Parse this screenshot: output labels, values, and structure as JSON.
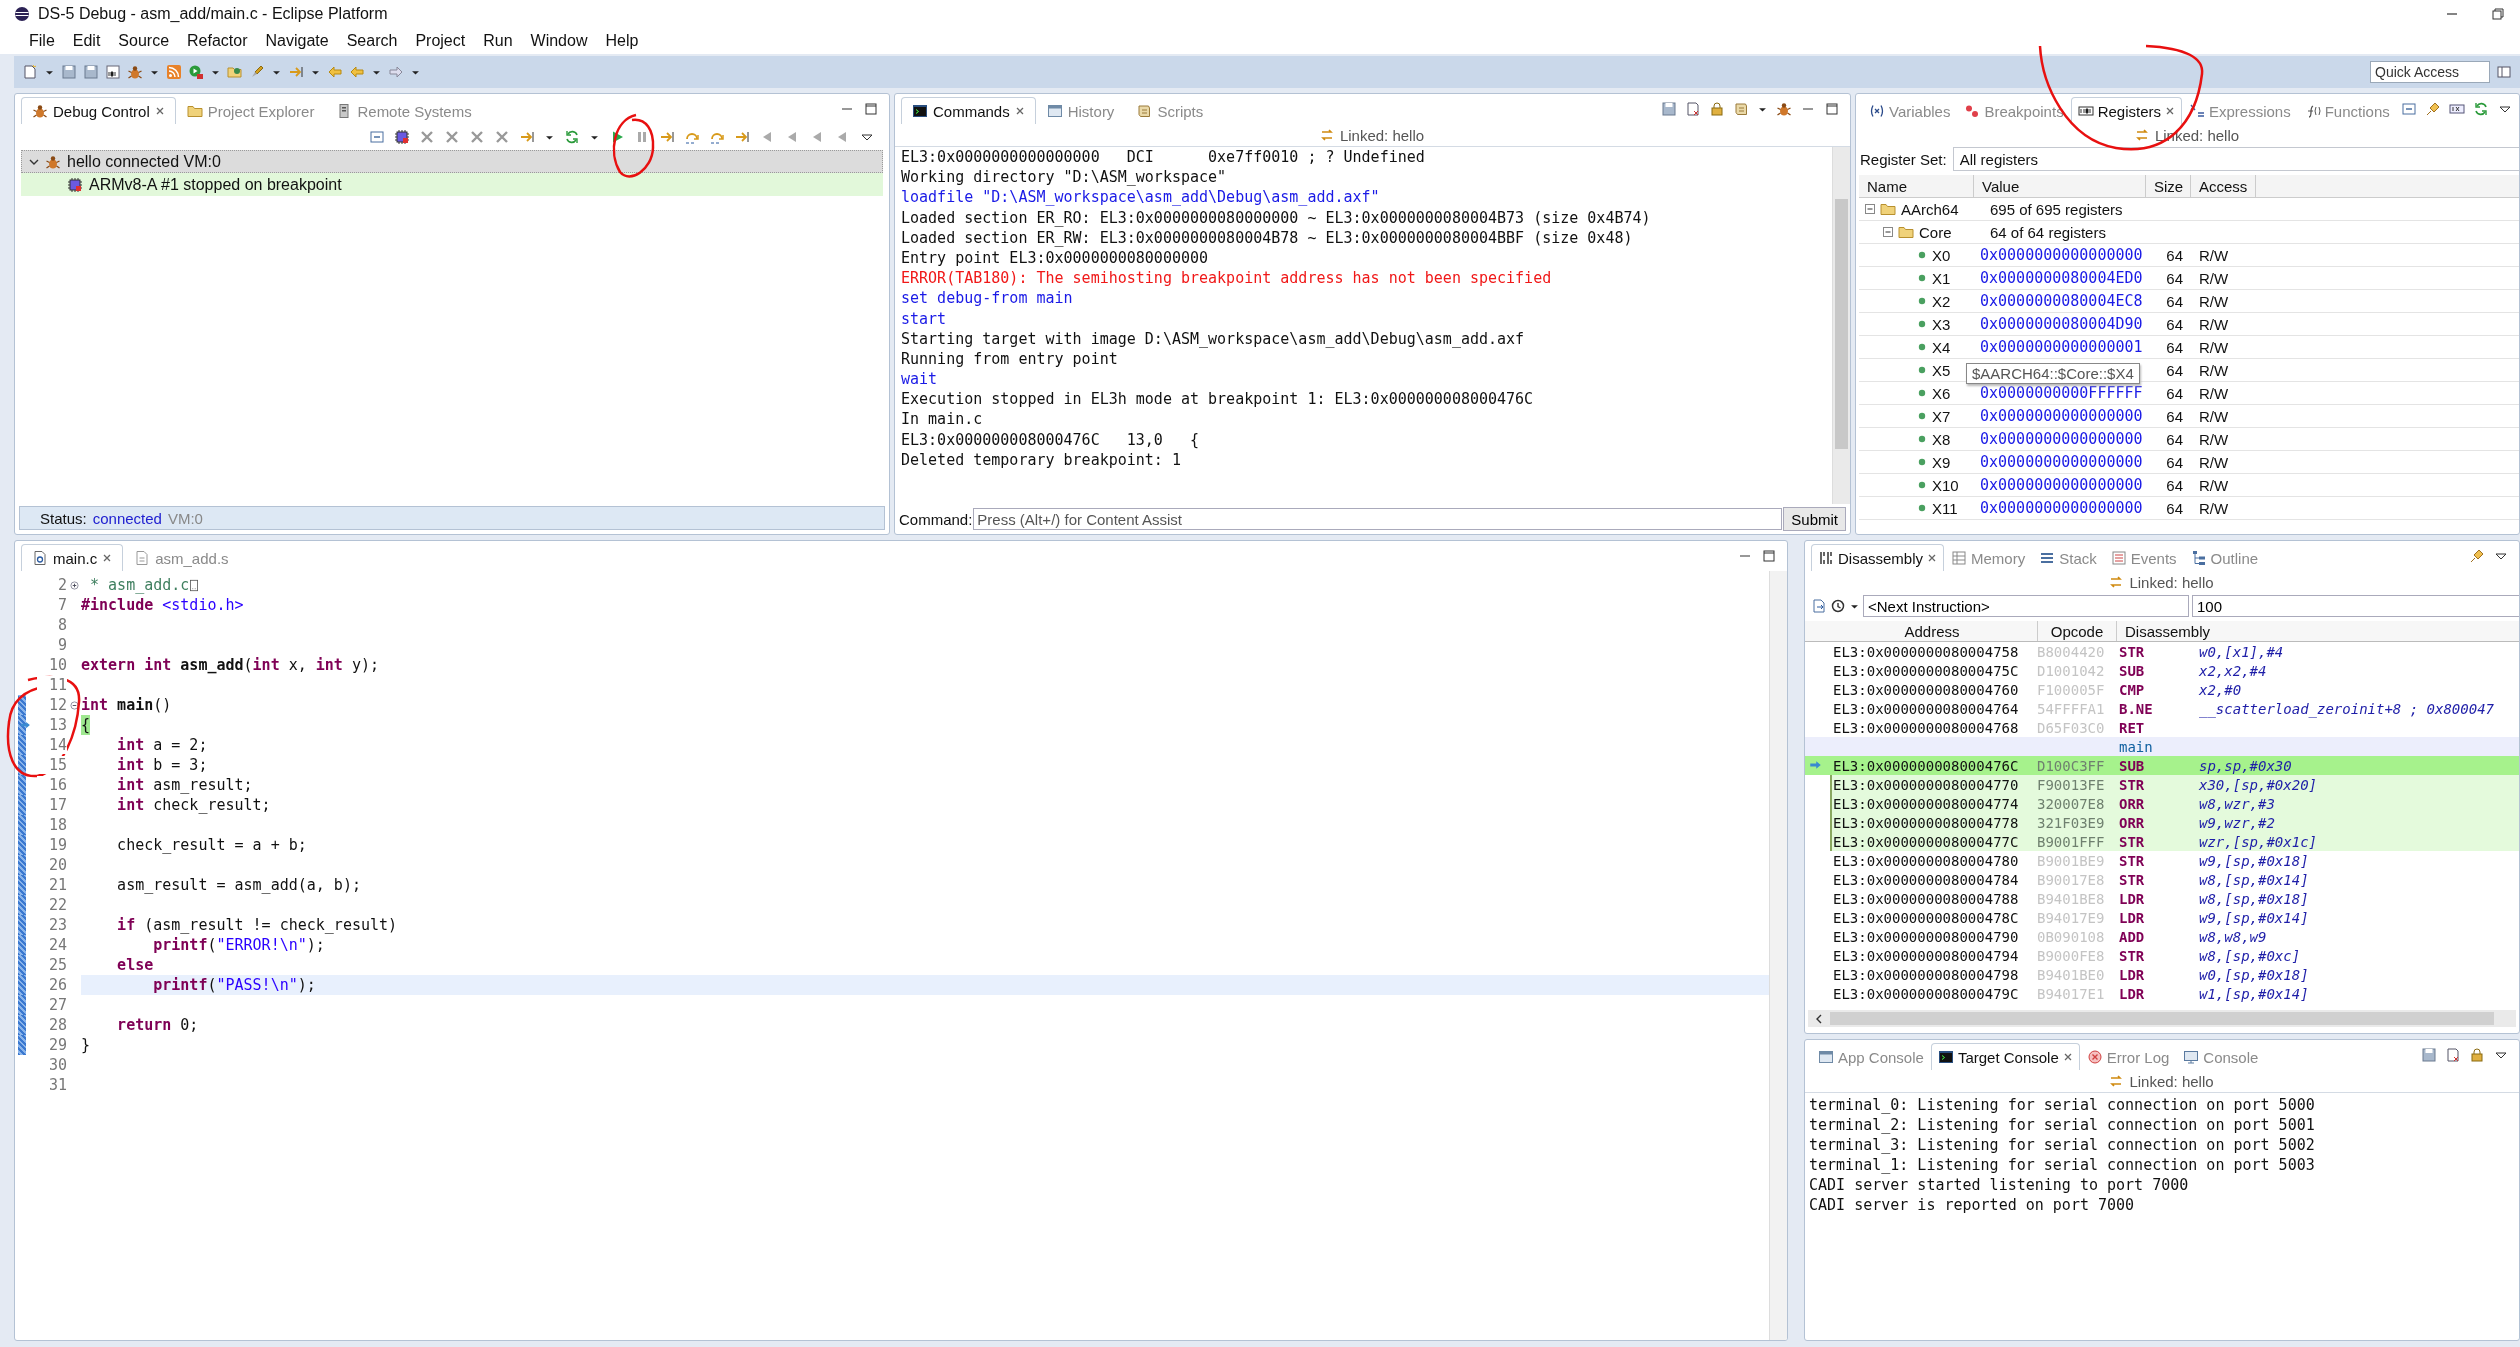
{
  "window": {
    "title": "DS-5 Debug - asm_add/main.c - Eclipse Platform"
  },
  "menu": [
    "File",
    "Edit",
    "Source",
    "Refactor",
    "Navigate",
    "Search",
    "Project",
    "Run",
    "Window",
    "Help"
  ],
  "quick_access": {
    "placeholder": "Quick Access"
  },
  "debug_control": {
    "tabs": [
      {
        "label": "Debug Control",
        "selected": true
      },
      {
        "label": "Project Explorer",
        "selected": false
      },
      {
        "label": "Remote Systems",
        "selected": false
      }
    ],
    "tree": [
      {
        "label": "hello connected VM:0",
        "selected": true,
        "current": false,
        "expanded": true,
        "children": [
          {
            "label": "ARMv8-A #1 stopped on breakpoint",
            "selected": false,
            "current": true
          }
        ]
      }
    ],
    "status": {
      "label": "Status:",
      "state": "connected",
      "detail": "VM:0"
    }
  },
  "commands": {
    "tabs": [
      {
        "label": "Commands",
        "selected": true
      },
      {
        "label": "History",
        "selected": false
      },
      {
        "label": "Scripts",
        "selected": false
      }
    ],
    "linked": "Linked: hello",
    "log": [
      {
        "kind": "output",
        "text": "EL3:0x0000000000000000   DCI      0xe7ff0010 ; ? Undefined"
      },
      {
        "kind": "output",
        "text": "Working directory \"D:\\ASM_workspace\""
      },
      {
        "kind": "command",
        "text": "loadfile \"D:\\ASM_workspace\\asm_add\\Debug\\asm_add.axf\""
      },
      {
        "kind": "output",
        "text": "Loaded section ER_RO: EL3:0x0000000080000000 ~ EL3:0x0000000080004B73 (size 0x4B74)"
      },
      {
        "kind": "output",
        "text": "Loaded section ER_RW: EL3:0x0000000080004B78 ~ EL3:0x0000000080004BBF (size 0x48)"
      },
      {
        "kind": "output",
        "text": "Entry point EL3:0x0000000080000000"
      },
      {
        "kind": "error",
        "text": "ERROR(TAB180): The semihosting breakpoint address has not been specified"
      },
      {
        "kind": "command",
        "text": "set debug-from main"
      },
      {
        "kind": "command",
        "text": "start"
      },
      {
        "kind": "output",
        "text": "Starting target with image D:\\ASM_workspace\\asm_add\\Debug\\asm_add.axf"
      },
      {
        "kind": "output",
        "text": "Running from entry point"
      },
      {
        "kind": "command",
        "text": "wait"
      },
      {
        "kind": "output",
        "text": "Execution stopped in EL3h mode at breakpoint 1: EL3:0x000000008000476C"
      },
      {
        "kind": "output",
        "text": "In main.c"
      },
      {
        "kind": "output",
        "text": "EL3:0x000000008000476C   13,0   {"
      },
      {
        "kind": "output",
        "text": "Deleted temporary breakpoint: 1"
      }
    ],
    "command_field": {
      "label": "Command:",
      "placeholder": "Press (Alt+/) for Content Assist"
    },
    "submit": "Submit"
  },
  "registers": {
    "tabs": [
      {
        "label": "Variables",
        "selected": false
      },
      {
        "label": "Breakpoints",
        "selected": false
      },
      {
        "label": "Registers",
        "selected": true
      },
      {
        "label": "Expressions",
        "selected": false
      },
      {
        "label": "Functions",
        "selected": false
      }
    ],
    "linked": "Linked: hello",
    "register_set": {
      "label": "Register Set:",
      "value": "All registers"
    },
    "columns": [
      "Name",
      "Value",
      "Size",
      "Access"
    ],
    "tree": [
      {
        "name": "AArch64",
        "value": "695 of 695 registers",
        "expanded": true,
        "children": [
          {
            "name": "Core",
            "value": "64 of 64 registers",
            "expanded": true,
            "children": [
              {
                "name": "X0",
                "value": "0x0000000000000000",
                "size": "64",
                "access": "R/W"
              },
              {
                "name": "X1",
                "value": "0x0000000080004ED0",
                "size": "64",
                "access": "R/W"
              },
              {
                "name": "X2",
                "value": "0x0000000080004EC8",
                "size": "64",
                "access": "R/W"
              },
              {
                "name": "X3",
                "value": "0x0000000080004D90",
                "size": "64",
                "access": "R/W"
              },
              {
                "name": "X4",
                "value": "0x0000000000000001",
                "size": "64",
                "access": "R/W"
              },
              {
                "name": "X5",
                "tooltip": "$AARCH64::$Core::$X4",
                "size": "64",
                "access": "R/W"
              },
              {
                "name": "X6",
                "value": "0x0000000000FFFFFF",
                "size": "64",
                "access": "R/W"
              },
              {
                "name": "X7",
                "value": "0x0000000000000000",
                "size": "64",
                "access": "R/W"
              },
              {
                "name": "X8",
                "value": "0x0000000000000000",
                "size": "64",
                "access": "R/W"
              },
              {
                "name": "X9",
                "value": "0x0000000000000000",
                "size": "64",
                "access": "R/W"
              },
              {
                "name": "X10",
                "value": "0x0000000000000000",
                "size": "64",
                "access": "R/W"
              },
              {
                "name": "X11",
                "value": "0x0000000000000000",
                "size": "64",
                "access": "R/W"
              }
            ]
          }
        ]
      }
    ]
  },
  "editor": {
    "tabs": [
      {
        "label": "main.c",
        "selected": true
      },
      {
        "label": "asm_add.s",
        "selected": false
      }
    ],
    "lines": [
      {
        "number": "2",
        "folded": true,
        "marked": false,
        "current": false,
        "highlighted": false,
        "tokens": [
          {
            "kind": "comment",
            "text": " * asm_add.c"
          }
        ]
      },
      {
        "number": "7",
        "marked": false,
        "current": false,
        "highlighted": false,
        "tokens": [
          {
            "kind": "keyword",
            "text": "#include"
          },
          {
            "kind": "string",
            "text": " <stdio.h>"
          }
        ]
      },
      {
        "number": "8",
        "marked": false,
        "current": false,
        "highlighted": false
      },
      {
        "number": "9",
        "marked": false,
        "current": false,
        "highlighted": false
      },
      {
        "number": "10",
        "marked": false,
        "current": false,
        "highlighted": false,
        "tokens": [
          {
            "kind": "keyword",
            "text": "extern"
          },
          {
            "kind": "keyword",
            "text": " int"
          },
          {
            "kind": "function",
            "text": " asm_add"
          },
          {
            "kind": "plain",
            "text": "("
          },
          {
            "kind": "keyword",
            "text": "int"
          },
          {
            "kind": "plain",
            "text": " x, "
          },
          {
            "kind": "keyword",
            "text": "int"
          },
          {
            "kind": "plain",
            "text": " y);"
          }
        ]
      },
      {
        "number": "11",
        "marked": false,
        "current": false,
        "highlighted": false
      },
      {
        "number": "12",
        "folded": false,
        "marked": true,
        "current": false,
        "highlighted": false,
        "tokens": [
          {
            "kind": "keyword",
            "text": "int"
          },
          {
            "kind": "function",
            "text": " main"
          },
          {
            "kind": "plain",
            "text": "()"
          }
        ]
      },
      {
        "number": "13",
        "marked": true,
        "current": true,
        "highlighted": false,
        "tokens": [
          {
            "kind": "plain",
            "text": "{"
          }
        ]
      },
      {
        "number": "14",
        "marked": true,
        "current": false,
        "highlighted": false,
        "tokens": [
          {
            "kind": "keyword",
            "text": "    int"
          },
          {
            "kind": "plain",
            "text": " a = 2;"
          }
        ]
      },
      {
        "number": "15",
        "marked": true,
        "current": false,
        "highlighted": false,
        "tokens": [
          {
            "kind": "keyword",
            "text": "    int"
          },
          {
            "kind": "plain",
            "text": " b = 3;"
          }
        ]
      },
      {
        "number": "16",
        "marked": true,
        "current": false,
        "highlighted": false,
        "tokens": [
          {
            "kind": "keyword",
            "text": "    int"
          },
          {
            "kind": "plain",
            "text": " asm_result;"
          }
        ]
      },
      {
        "number": "17",
        "marked": true,
        "current": false,
        "highlighted": false,
        "tokens": [
          {
            "kind": "keyword",
            "text": "    int"
          },
          {
            "kind": "plain",
            "text": " check_result;"
          }
        ]
      },
      {
        "number": "18",
        "marked": true,
        "current": false,
        "highlighted": false
      },
      {
        "number": "19",
        "marked": true,
        "current": false,
        "highlighted": false,
        "tokens": [
          {
            "kind": "plain",
            "text": "    check_result = a + b;"
          }
        ]
      },
      {
        "number": "20",
        "marked": true,
        "current": false,
        "highlighted": false
      },
      {
        "number": "21",
        "marked": true,
        "current": false,
        "highlighted": false,
        "tokens": [
          {
            "kind": "plain",
            "text": "    asm_result = asm_add(a, b);"
          }
        ]
      },
      {
        "number": "22",
        "marked": true,
        "current": false,
        "highlighted": false
      },
      {
        "number": "23",
        "marked": true,
        "current": false,
        "highlighted": false,
        "tokens": [
          {
            "kind": "keyword",
            "text": "    if"
          },
          {
            "kind": "plain",
            "text": " (asm_result != check_result)"
          }
        ]
      },
      {
        "number": "24",
        "marked": true,
        "current": false,
        "highlighted": false,
        "tokens": [
          {
            "kind": "keyword",
            "text": "        printf"
          },
          {
            "kind": "plain",
            "text": "("
          },
          {
            "kind": "string",
            "text": "\"ERROR!\\n\""
          },
          {
            "kind": "plain",
            "text": ");"
          }
        ]
      },
      {
        "number": "25",
        "marked": true,
        "current": false,
        "highlighted": false,
        "tokens": [
          {
            "kind": "keyword",
            "text": "    else"
          }
        ]
      },
      {
        "number": "26",
        "marked": true,
        "current": false,
        "highlighted": true,
        "tokens": [
          {
            "kind": "keyword",
            "text": "        printf"
          },
          {
            "kind": "plain",
            "text": "("
          },
          {
            "kind": "string",
            "text": "\"PASS!\\n\""
          },
          {
            "kind": "plain",
            "text": ");"
          }
        ]
      },
      {
        "number": "27",
        "marked": true,
        "current": false,
        "highlighted": false
      },
      {
        "number": "28",
        "marked": true,
        "current": false,
        "highlighted": false,
        "tokens": [
          {
            "kind": "keyword",
            "text": "    return"
          },
          {
            "kind": "plain",
            "text": " 0;"
          }
        ]
      },
      {
        "number": "29",
        "marked": true,
        "current": false,
        "highlighted": false,
        "tokens": [
          {
            "kind": "plain",
            "text": "}"
          }
        ]
      },
      {
        "number": "30",
        "marked": false,
        "current": false,
        "highlighted": false
      },
      {
        "number": "31",
        "marked": false,
        "current": false,
        "highlighted": false
      }
    ]
  },
  "disassembly": {
    "tabs": [
      {
        "label": "Disassembly",
        "selected": true
      },
      {
        "label": "Memory",
        "selected": false
      },
      {
        "label": "Stack",
        "selected": false
      },
      {
        "label": "Events",
        "selected": false
      },
      {
        "label": "Outline",
        "selected": false
      }
    ],
    "linked": "Linked: hello",
    "address_field": {
      "value": "<Next Instruction>"
    },
    "count_field": {
      "value": "100"
    },
    "columns": [
      "Address",
      "Opcode",
      "Disassembly"
    ],
    "rows": [
      {
        "kind": "instruction",
        "address": "EL3:0x0000000080004758",
        "opcode": "B8004420",
        "mnemonic": "STR",
        "operands": "w0,[x1],#4",
        "current": false,
        "in_source": false
      },
      {
        "kind": "instruction",
        "address": "EL3:0x000000008000475C",
        "opcode": "D1001042",
        "mnemonic": "SUB",
        "operands": "x2,x2,#4",
        "current": false,
        "in_source": false
      },
      {
        "kind": "instruction",
        "address": "EL3:0x0000000080004760",
        "opcode": "F100005F",
        "mnemonic": "CMP",
        "operands": "x2,#0",
        "current": false,
        "in_source": false
      },
      {
        "kind": "instruction",
        "address": "EL3:0x0000000080004764",
        "opcode": "54FFFFA1",
        "mnemonic": "B.NE",
        "operands": "__scatterload_zeroinit+8 ; 0x800047",
        "current": false,
        "in_source": false
      },
      {
        "kind": "instruction",
        "address": "EL3:0x0000000080004768",
        "opcode": "D65F03C0",
        "mnemonic": "RET",
        "current": false,
        "in_source": false
      },
      {
        "kind": "label",
        "text": "main"
      },
      {
        "kind": "instruction",
        "address": "EL3:0x000000008000476C",
        "opcode": "D100C3FF",
        "mnemonic": "SUB",
        "operands": "sp,sp,#0x30",
        "current": true,
        "in_source": false
      },
      {
        "kind": "instruction",
        "address": "EL3:0x0000000080004770",
        "opcode": "F90013FE",
        "mnemonic": "STR",
        "operands": "x30,[sp,#0x20]",
        "current": false,
        "in_source": true
      },
      {
        "kind": "instruction",
        "address": "EL3:0x0000000080004774",
        "opcode": "320007E8",
        "mnemonic": "ORR",
        "operands": "w8,wzr,#3",
        "current": false,
        "in_source": true
      },
      {
        "kind": "instruction",
        "address": "EL3:0x0000000080004778",
        "opcode": "321F03E9",
        "mnemonic": "ORR",
        "operands": "w9,wzr,#2",
        "current": false,
        "in_source": true
      },
      {
        "kind": "instruction",
        "address": "EL3:0x000000008000477C",
        "opcode": "B9001FFF",
        "mnemonic": "STR",
        "operands": "wzr,[sp,#0x1c]",
        "current": false,
        "in_source": true
      },
      {
        "kind": "instruction",
        "address": "EL3:0x0000000080004780",
        "opcode": "B9001BE9",
        "mnemonic": "STR",
        "operands": "w9,[sp,#0x18]",
        "current": false,
        "in_source": false
      },
      {
        "kind": "instruction",
        "address": "EL3:0x0000000080004784",
        "opcode": "B90017E8",
        "mnemonic": "STR",
        "operands": "w8,[sp,#0x14]",
        "current": false,
        "in_source": false
      },
      {
        "kind": "instruction",
        "address": "EL3:0x0000000080004788",
        "opcode": "B9401BE8",
        "mnemonic": "LDR",
        "operands": "w8,[sp,#0x18]",
        "current": false,
        "in_source": false
      },
      {
        "kind": "instruction",
        "address": "EL3:0x000000008000478C",
        "opcode": "B94017E9",
        "mnemonic": "LDR",
        "operands": "w9,[sp,#0x14]",
        "current": false,
        "in_source": false
      },
      {
        "kind": "instruction",
        "address": "EL3:0x0000000080004790",
        "opcode": "0B090108",
        "mnemonic": "ADD",
        "operands": "w8,w8,w9",
        "current": false,
        "in_source": false
      },
      {
        "kind": "instruction",
        "address": "EL3:0x0000000080004794",
        "opcode": "B9000FE8",
        "mnemonic": "STR",
        "operands": "w8,[sp,#0xc]",
        "current": false,
        "in_source": false
      },
      {
        "kind": "instruction",
        "address": "EL3:0x0000000080004798",
        "opcode": "B9401BE0",
        "mnemonic": "LDR",
        "operands": "w0,[sp,#0x18]",
        "current": false,
        "in_source": false
      },
      {
        "kind": "instruction",
        "address": "EL3:0x000000008000479C",
        "opcode": "B94017E1",
        "mnemonic": "LDR",
        "operands": "w1,[sp,#0x14]",
        "current": false,
        "in_source": false
      }
    ]
  },
  "console": {
    "tabs": [
      {
        "label": "App Console",
        "selected": false
      },
      {
        "label": "Target Console",
        "selected": true
      },
      {
        "label": "Error Log",
        "selected": false
      },
      {
        "label": "Console",
        "selected": false
      }
    ],
    "linked": "Linked: hello",
    "lines": [
      "terminal_0: Listening for serial connection on port 5000",
      "terminal_2: Listening for serial connection on port 5001",
      "terminal_3: Listening for serial connection on port 5002",
      "terminal_1: Listening for serial connection on port 5003",
      "CADI server started listening to port 7000",
      "CADI server is reported on port 7000"
    ]
  }
}
